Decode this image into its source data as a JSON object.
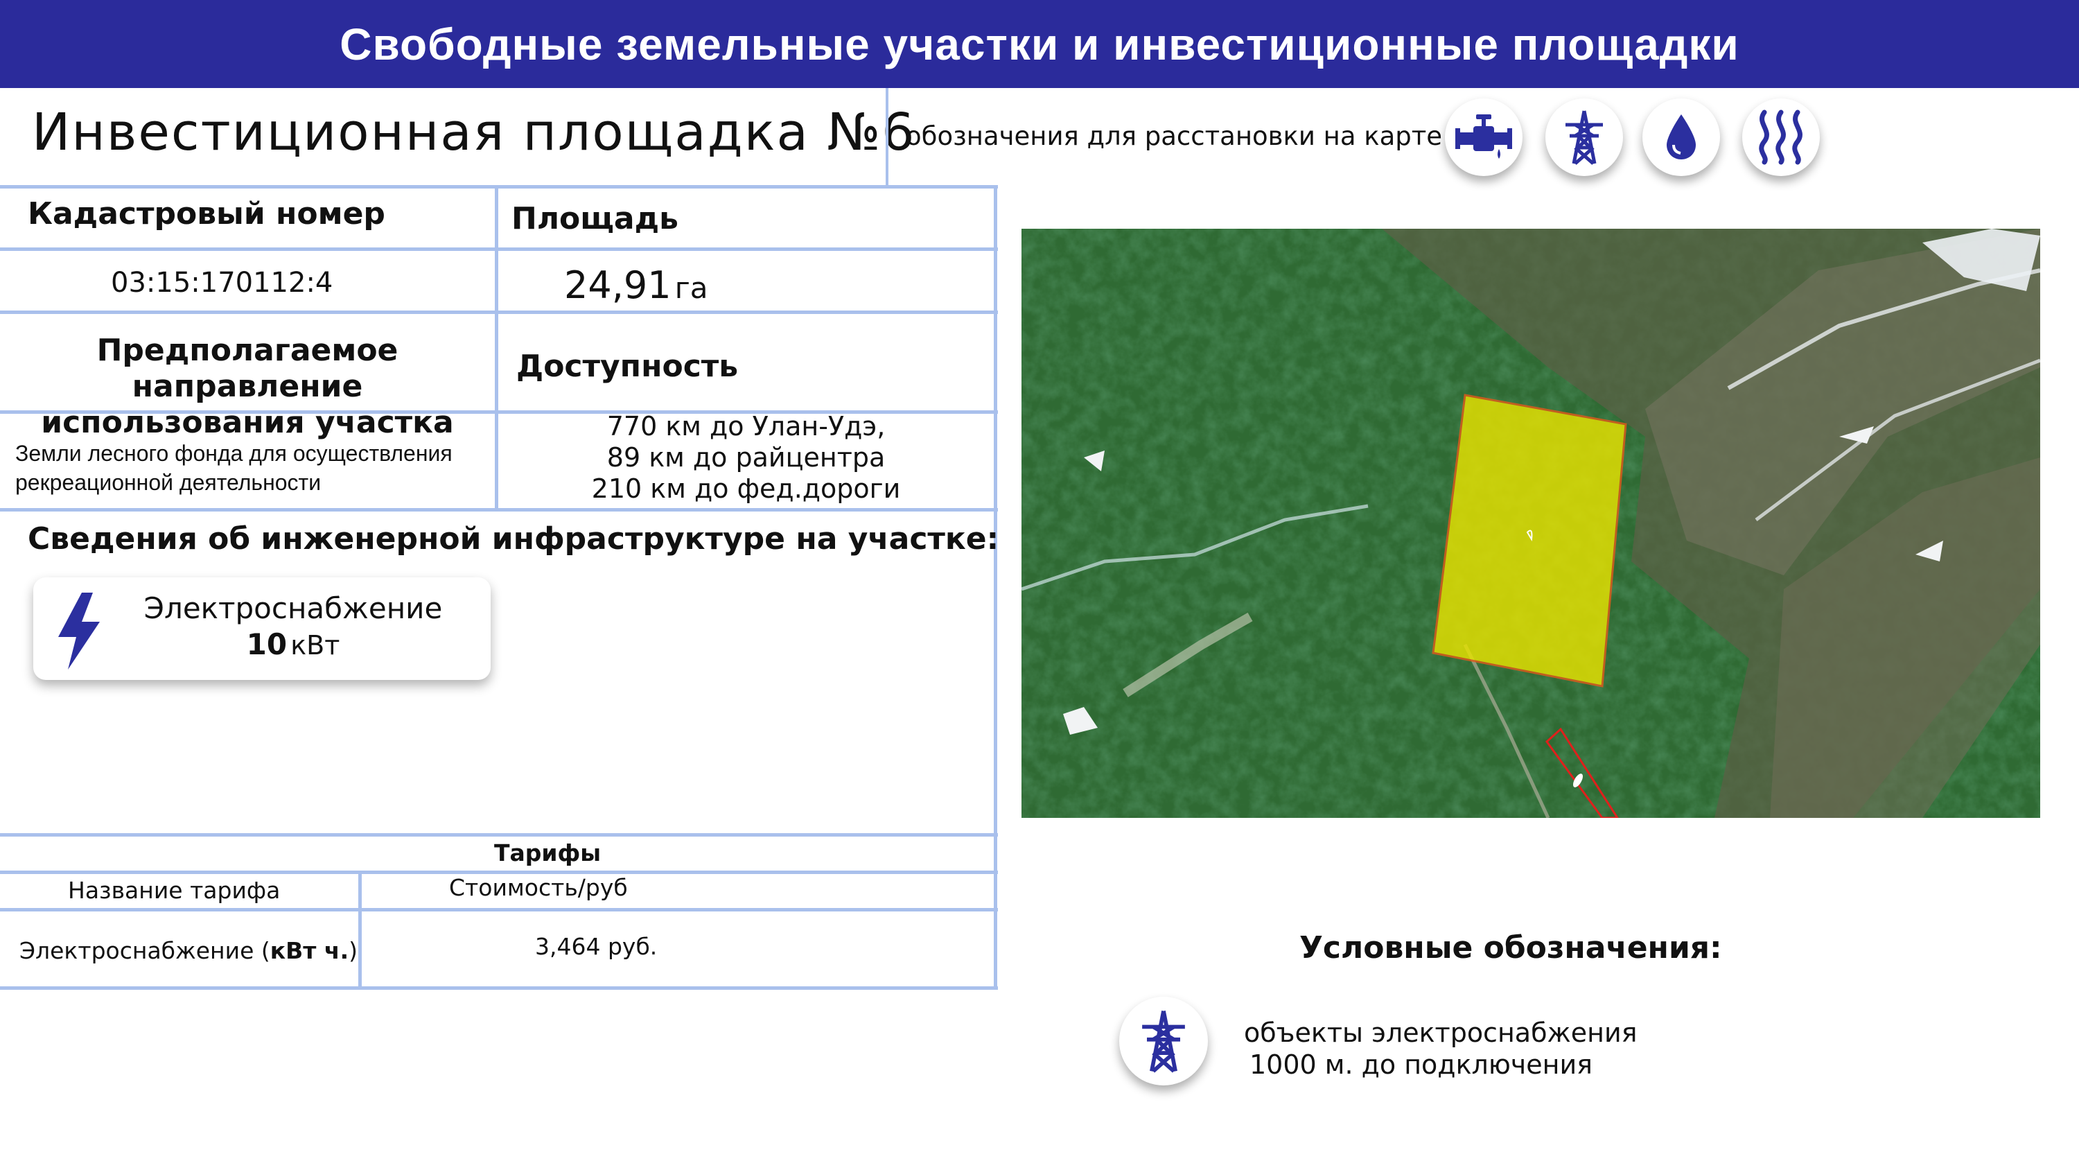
{
  "banner": {
    "title": "Свободные земельные участки и инвестиционные площадки"
  },
  "site": {
    "title": "Инвестиционная площадка  №6"
  },
  "legend_hint": "обозначения для расстановки на карте",
  "top_icons": [
    "water-pipe-icon",
    "power-tower-icon",
    "water-drop-icon",
    "heat-icon"
  ],
  "table": {
    "cadastral_label": "Кадастровый номер",
    "cadastral_value": "03:15:170112:4",
    "area_label": "Площадь",
    "area_value": "24,91",
    "area_unit": "га",
    "purpose_label_1": "Предполагаемое направление",
    "purpose_label_2": "использования участка",
    "purpose_value_1": "Земли лесного фонда для осуществления",
    "purpose_value_2": "рекреационной деятельности",
    "access_label": "Доступность",
    "access_lines": [
      "770 км до Улан-Удэ,",
      "89 км до райцентра",
      "210 км до фед.дороги"
    ]
  },
  "infra": {
    "title": "Сведения об инженерной инфраструктуре на участке:",
    "power_label": "Электроснабжение",
    "power_value": "10",
    "power_unit": "кВт"
  },
  "tariffs": {
    "title": "Тарифы",
    "col_name": "Название тарифа",
    "col_cost": "Стоимость/руб",
    "row_name": "Электроснабжение (",
    "row_name_bold": "кВт ч.",
    "row_name_end": ")",
    "row_cost": "3,464 руб."
  },
  "legend": {
    "title": "Условные обозначения:",
    "item_line1": "объекты электроснабжения",
    "item_line2": "1000 м. до подключения"
  },
  "colors": {
    "banner": "#2b2b9b",
    "icon_blue": "#2b2f9f",
    "grid_line": "#a9c0ec",
    "plot_fill": "#e8e300"
  }
}
